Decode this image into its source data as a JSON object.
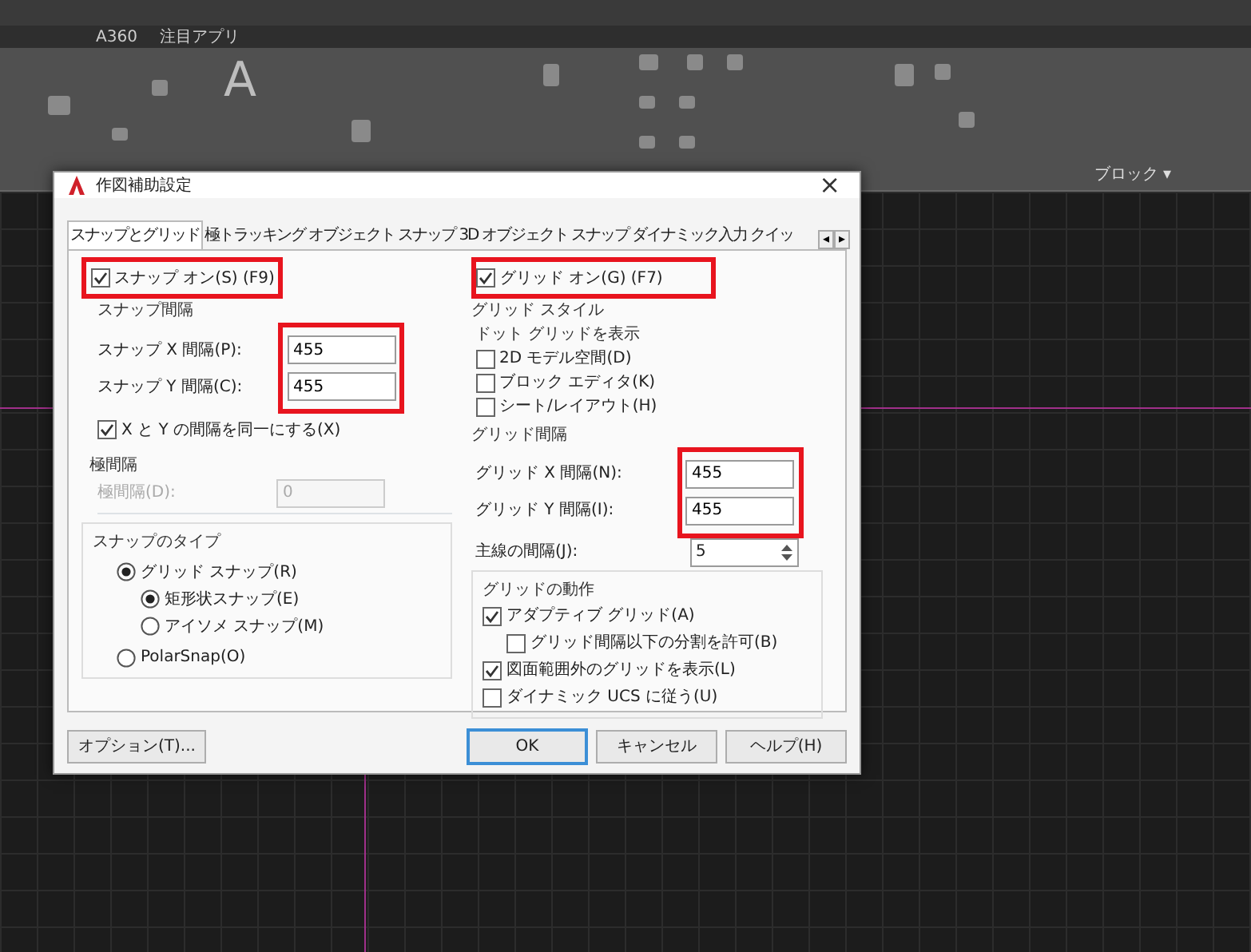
{
  "app": {
    "quick_tabs": [
      "A360",
      "注目アプリ"
    ],
    "ribbon_text_icon": "A",
    "panel_label": "ブロック ▾"
  },
  "dialog": {
    "title": "作図補助設定",
    "close": "×",
    "tabs": [
      {
        "label": "スナップとグリッド",
        "selected": true
      },
      {
        "label": "極トラッキング",
        "selected": false
      },
      {
        "label": "オブジェクト スナップ",
        "selected": false
      },
      {
        "label": "3D オブジェクト スナップ",
        "selected": false
      },
      {
        "label": "ダイナミック入力",
        "selected": false
      },
      {
        "label": "クイッ",
        "selected": false
      }
    ],
    "tab_scroll": [
      "◂",
      "▸"
    ],
    "snap_on": {
      "label": "スナップ オン(S) (F9)",
      "checked": true,
      "highlighted": true
    },
    "snap_spacing": {
      "title": "スナップ間隔",
      "highlighted": true,
      "fields": [
        {
          "label": "スナップ X 間隔(P):",
          "value": "455"
        },
        {
          "label": "スナップ Y 間隔(C):",
          "value": "455"
        }
      ],
      "equal_xy": {
        "label": "X と Y の間隔を同一にする(X)",
        "checked": true
      }
    },
    "polar_spacing": {
      "title": "極間隔",
      "label": "極間隔(D):",
      "value": "0",
      "disabled": true
    },
    "snap_type": {
      "title": "スナップのタイプ",
      "options": [
        {
          "label": "グリッド スナップ(R)",
          "selected": true,
          "children": [
            {
              "label": "矩形状スナップ(E)",
              "selected": true
            },
            {
              "label": "アイソメ スナップ(M)",
              "selected": false
            }
          ]
        },
        {
          "label": "PolarSnap(O)",
          "selected": false
        }
      ]
    },
    "grid_on": {
      "label": "グリッド オン(G) (F7)",
      "checked": true,
      "highlighted": true
    },
    "grid_style": {
      "title": "グリッド スタイル",
      "subtitle": "ドット グリッドを表示",
      "options": [
        {
          "label": "2D モデル空間(D)",
          "checked": false
        },
        {
          "label": "ブロック エディタ(K)",
          "checked": false
        },
        {
          "label": "シート/レイアウト(H)",
          "checked": false
        }
      ]
    },
    "grid_spacing": {
      "title": "グリッド間隔",
      "highlighted": true,
      "fields": [
        {
          "label": "グリッド X 間隔(N):",
          "value": "455"
        },
        {
          "label": "グリッド Y 間隔(I):",
          "value": "455"
        }
      ],
      "major": {
        "label": "主線の間隔(J):",
        "value": "5"
      }
    },
    "grid_behavior": {
      "title": "グリッドの動作",
      "options": [
        {
          "label": "アダプティブ グリッド(A)",
          "checked": true,
          "children": [
            {
              "label": "グリッド間隔以下の分割を許可(B)",
              "checked": false
            }
          ]
        },
        {
          "label": "図面範囲外のグリッドを表示(L)",
          "checked": true
        },
        {
          "label": "ダイナミック UCS に従う(U)",
          "checked": false
        }
      ]
    },
    "buttons": [
      {
        "label": "オプション(T)...",
        "kind": "aside"
      },
      {
        "label": "OK",
        "kind": "default"
      },
      {
        "label": "キャンセル",
        "kind": "normal"
      },
      {
        "label": "ヘルプ(H)",
        "kind": "normal"
      }
    ]
  }
}
